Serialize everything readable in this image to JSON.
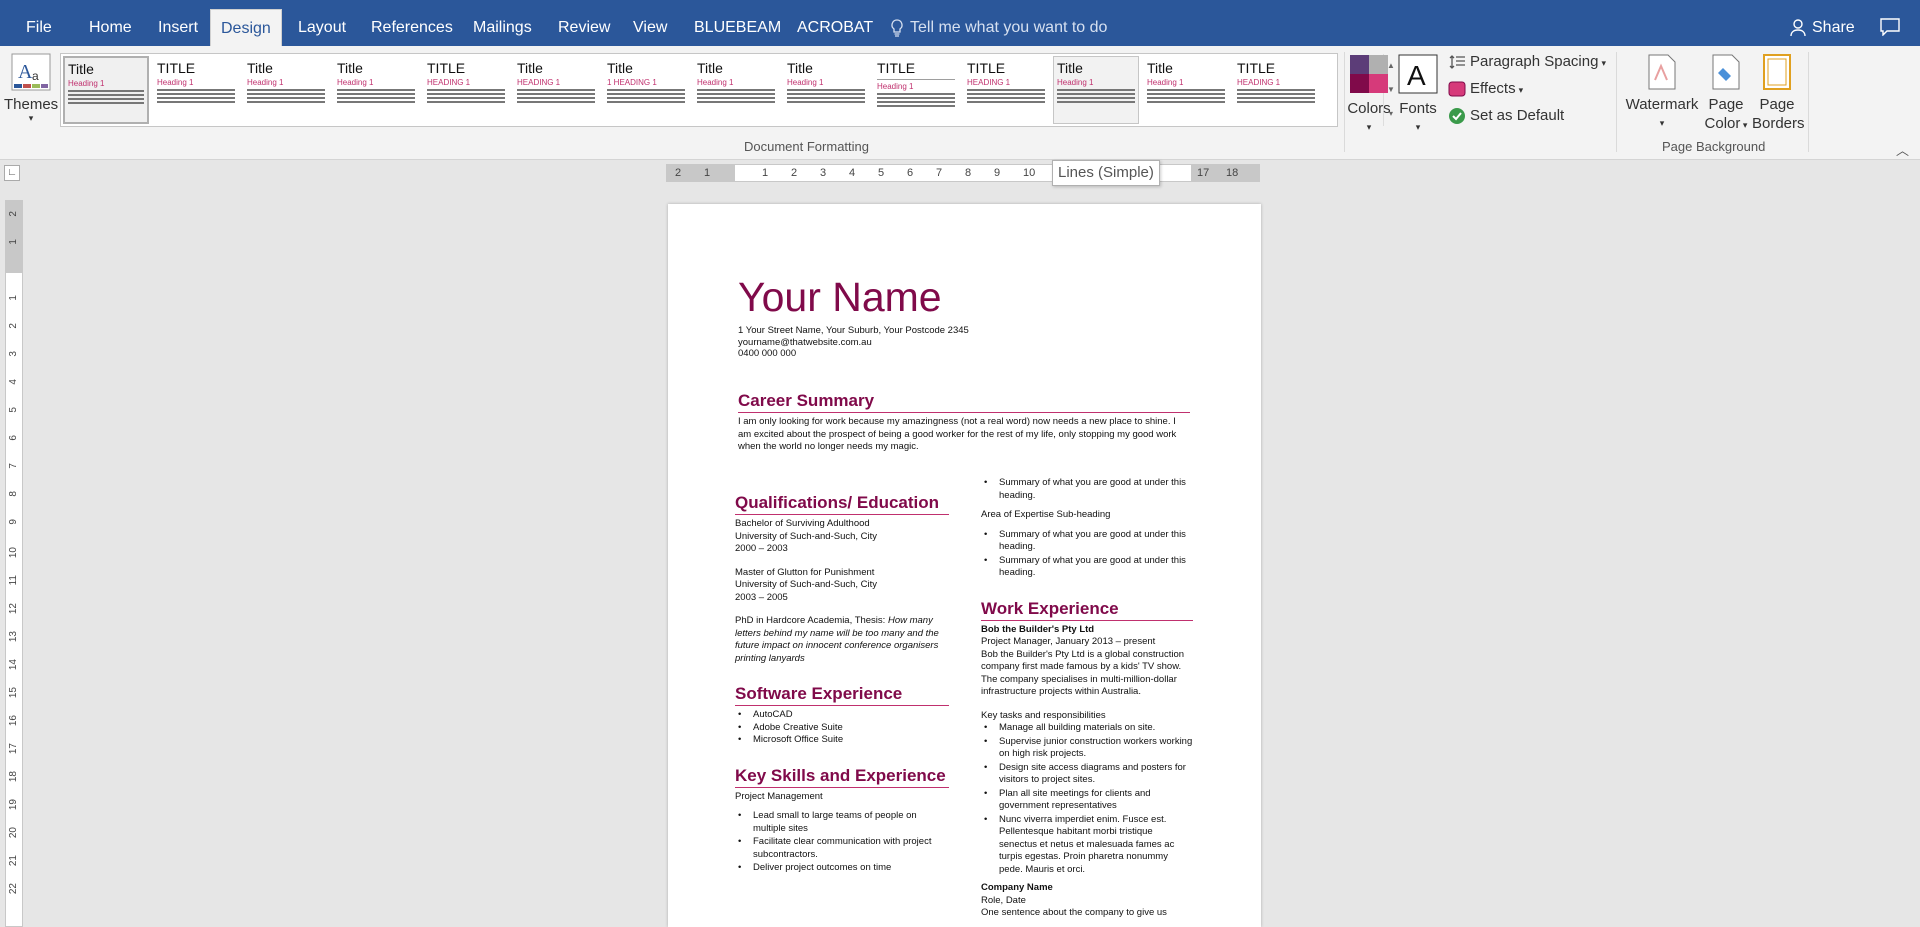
{
  "tabs": {
    "file": "File",
    "home": "Home",
    "insert": "Insert",
    "design": "Design",
    "layout": "Layout",
    "references": "References",
    "mailings": "Mailings",
    "review": "Review",
    "view": "View",
    "bluebeam": "BLUEBEAM",
    "acrobat": "ACROBAT"
  },
  "tell_me": "Tell me what you want to do",
  "share": "Share",
  "ribbon": {
    "themes_label": "Themes",
    "group_document_formatting": "Document Formatting",
    "group_page_background": "Page Background",
    "colors": "Colors",
    "fonts": "Fonts",
    "paragraph_spacing": "Paragraph Spacing",
    "effects": "Effects",
    "set_as_default": "Set as Default",
    "watermark": "Watermark",
    "page_color_1": "Page",
    "page_color_2": "Color",
    "page_borders_1": "Page",
    "page_borders_2": "Borders",
    "styles": [
      {
        "title": "Title",
        "heading": "Heading 1"
      },
      {
        "title": "TITLE",
        "heading": "Heading 1"
      },
      {
        "title": "Title",
        "heading": "Heading 1"
      },
      {
        "title": "Title",
        "heading": "Heading 1"
      },
      {
        "title": "TITLE",
        "heading": "HEADING 1"
      },
      {
        "title": "Title",
        "heading": "HEADING 1"
      },
      {
        "title": "Title",
        "heading": "1 HEADING 1"
      },
      {
        "title": "Title",
        "heading": "Heading 1"
      },
      {
        "title": "Title",
        "heading": "Heading 1"
      },
      {
        "title": "TITLE",
        "heading": "Heading 1"
      },
      {
        "title": "TITLE",
        "heading": "HEADING 1"
      },
      {
        "title": "Title",
        "heading": "Heading 1"
      },
      {
        "title": "Title",
        "heading": "Heading 1"
      },
      {
        "title": "TITLE",
        "heading": "HEADING 1"
      }
    ]
  },
  "tooltip": "Lines (Simple)",
  "ruler": {
    "h_labels": [
      "2",
      "1",
      "",
      "1",
      "2",
      "3",
      "4",
      "5",
      "6",
      "7",
      "8",
      "9",
      "10",
      "11",
      "",
      "",
      "15",
      "",
      "17",
      "18"
    ],
    "v_labels": [
      "2",
      "1",
      "",
      "1",
      "2",
      "3",
      "4",
      "5",
      "6",
      "7",
      "8",
      "9",
      "10",
      "11",
      "12",
      "13",
      "14",
      "15",
      "16",
      "17",
      "18",
      "19",
      "20",
      "21",
      "22"
    ]
  },
  "doc": {
    "name": "Your Name",
    "address": "1 Your Street Name, Your Suburb, Your Postcode 2345",
    "email": "yourname@thatwebsite.com.au",
    "phone": "0400 000 000",
    "career_heading": "Career Summary",
    "career_text": "I am only looking for work because my amazingness (not a real word) now needs a new place to shine. I am excited about the prospect of being a good worker for the rest of my life, only stopping my good work when the world no longer needs my magic.",
    "qual_heading": "Qualifications/ Education",
    "qual1": [
      "Bachelor of Surviving Adulthood",
      "University of Such-and-Such, City",
      "2000 – 2003"
    ],
    "qual2": [
      "Master of Glutton for Punishment",
      "University of Such-and-Such, City",
      "2003 – 2005"
    ],
    "phd_prefix": "PhD in Hardcore Academia, Thesis: ",
    "phd_thesis": "How many letters behind my name will be too many and the future impact on innocent conference organisers printing lanyards",
    "software_heading": "Software Experience",
    "software": [
      "AutoCAD",
      "Adobe Creative Suite",
      "Microsoft Office Suite"
    ],
    "skills_heading": "Key Skills and Experience",
    "skills_sub": "Project Management",
    "skills": [
      "Lead small to large teams of people on multiple sites",
      "Facilitate clear communication with project subcontractors.",
      "Deliver project outcomes on time"
    ],
    "right_bullets1": [
      "Summary of what you are good at under this heading."
    ],
    "area_sub": "Area of Expertise Sub-heading",
    "right_bullets2": [
      "Summary of what you are good at under this heading.",
      "Summary of what you are good at under this heading."
    ],
    "work_heading": "Work Experience",
    "company1": "Bob the Builder's Pty Ltd",
    "role1": "Project Manager, January 2013 – present",
    "company1_desc": "Bob the Builder's Pty Ltd is a global construction company first made famous by a kids' TV show. The company specialises in multi-million-dollar infrastructure projects within Australia.",
    "tasks_label": "Key tasks and responsibilities",
    "tasks": [
      "Manage all building materials on site.",
      "Supervise junior construction workers working on high risk projects.",
      "Design site access diagrams and posters for visitors to project sites.",
      "Plan all site meetings for clients and government representatives",
      "Nunc viverra imperdiet enim. Fusce est. Pellentesque habitant morbi tristique senectus et netus et malesuada fames ac turpis egestas. Proin pharetra nonummy pede. Mauris et orci."
    ],
    "company2": "Company Name",
    "role2": "Role, Date",
    "company2_desc": "One sentence about the company to give us"
  }
}
